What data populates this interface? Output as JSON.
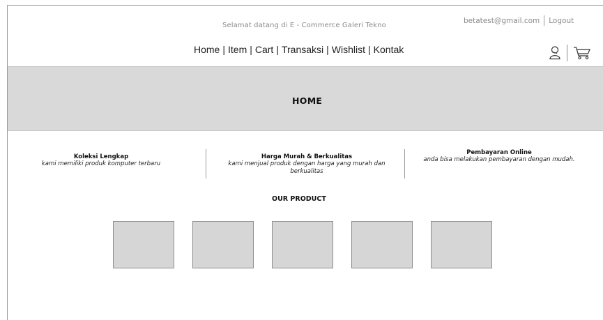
{
  "header": {
    "welcome": "Selamat datang di E - Commerce Galeri Tekno",
    "email": "betatest@gmail.com",
    "logout": "Logout"
  },
  "nav": {
    "items": [
      "Home",
      "Item",
      "Cart",
      "Transaksi",
      "Wishlist",
      "Kontak"
    ],
    "separator": "|"
  },
  "icons": [
    "user-icon",
    "cart-icon"
  ],
  "hero": {
    "title": "HOME"
  },
  "features": [
    {
      "title": "Koleksi Lengkap",
      "desc": "kami memiliki produk komputer terbaru"
    },
    {
      "title": "Harga Murah & Berkualitas",
      "desc": "kami menjual produk dengan harga yang murah dan berkualitas"
    },
    {
      "title": "Pembayaran Online",
      "desc": "anda bisa melakukan pembayaran dengan mudah."
    }
  ],
  "products": {
    "title": "OUR PRODUCT",
    "count": 5
  },
  "colors": {
    "hero_bg": "#d9d9d9",
    "product_bg": "#d6d6d6",
    "muted_text": "#8a8a8a"
  }
}
